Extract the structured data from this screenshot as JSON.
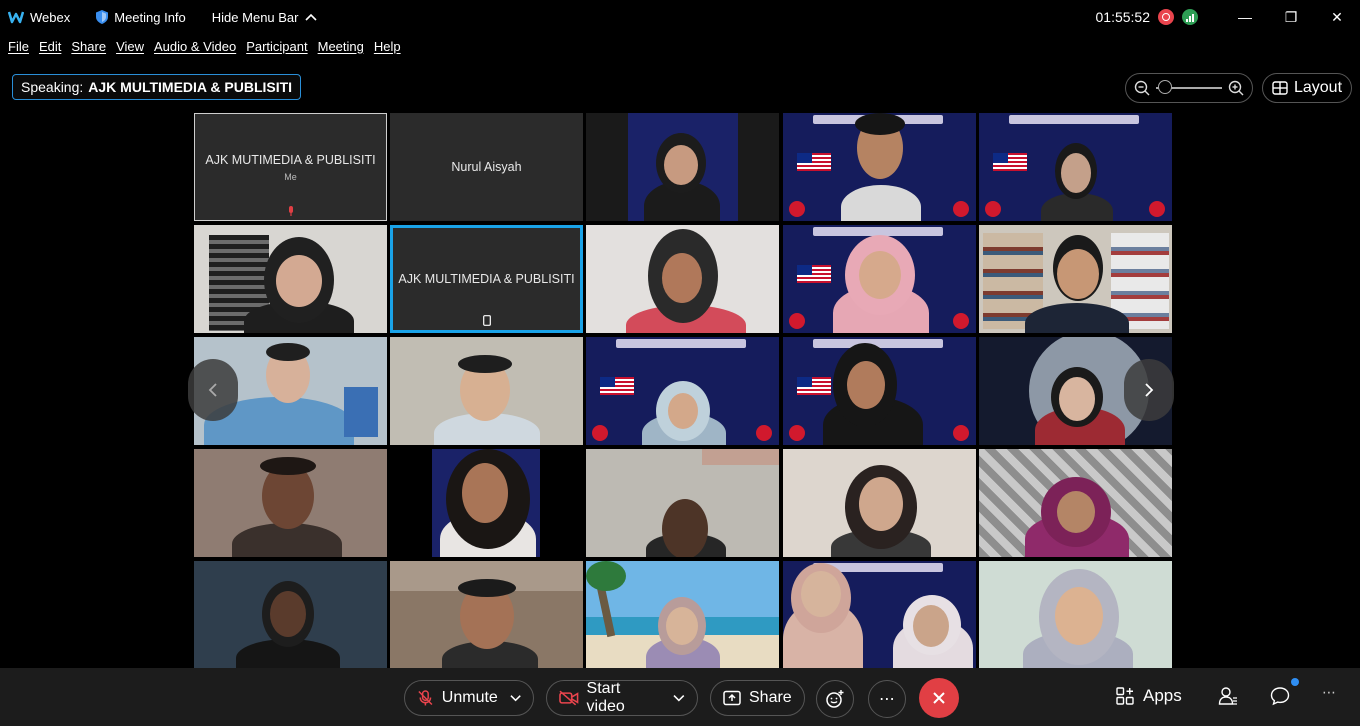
{
  "titlebar": {
    "app_name": "Webex",
    "meeting_info": "Meeting Info",
    "hide_menu": "Hide Menu Bar",
    "clock": "01:55:52",
    "minimize": "—",
    "restore": "❐",
    "close": "✕"
  },
  "menu": [
    "File",
    "Edit",
    "Share",
    "View",
    "Audio & Video",
    "Participant",
    "Meeting",
    "Help"
  ],
  "speaking": {
    "label": "Speaking:",
    "name": "AJK MULTIMEDIA & PUBLISITI"
  },
  "layout_label": "Layout",
  "tiles": {
    "self_name": "AJK MUTIMEDIA & PUBLISITI",
    "self_sub": "Me",
    "nurul": "Nurul Aisyah",
    "active_name": "AJK MULTIMEDIA & PUBLISITI"
  },
  "toolbar": {
    "unmute": "Unmute",
    "start_video": "Start video",
    "share": "Share",
    "apps": "Apps",
    "more": "⋯"
  },
  "colors": {
    "accent": "#1aa3e8",
    "end_call": "#e13f44",
    "record": "#e9444d",
    "network": "#2e9e55",
    "banner_bg": "#151c5c"
  }
}
